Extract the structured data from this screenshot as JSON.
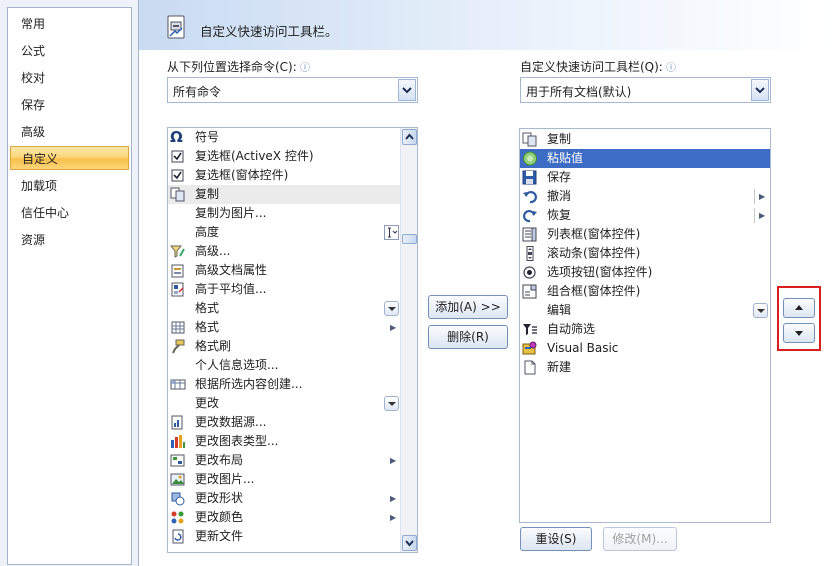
{
  "sidebar": {
    "items": [
      {
        "label": "常用",
        "active": false
      },
      {
        "label": "公式",
        "active": false
      },
      {
        "label": "校对",
        "active": false
      },
      {
        "label": "保存",
        "active": false
      },
      {
        "label": "高级",
        "active": false
      },
      {
        "label": "自定义",
        "active": true
      },
      {
        "label": "加载项",
        "active": false
      },
      {
        "label": "信任中心",
        "active": false
      },
      {
        "label": "资源",
        "active": false
      }
    ]
  },
  "header": {
    "title": "自定义快速访问工具栏。",
    "icon": "toolbar-customize-icon"
  },
  "left": {
    "label": "从下列位置选择命令(C):",
    "dropdown_value": "所有命令",
    "items": [
      {
        "label": "符号",
        "icon": "omega-icon"
      },
      {
        "label": "复选框(ActiveX 控件)",
        "icon": "checkbox-icon"
      },
      {
        "label": "复选框(窗体控件)",
        "icon": "checkbox-icon"
      },
      {
        "label": "复制",
        "icon": "copy-icon"
      },
      {
        "label": "复制为图片...",
        "icon": ""
      },
      {
        "label": "高度",
        "icon": ""
      },
      {
        "label": "高级...",
        "icon": "filter-advanced-icon"
      },
      {
        "label": "高级文档属性",
        "icon": "document-properties-icon"
      },
      {
        "label": "高于平均值...",
        "icon": "above-average-icon"
      },
      {
        "label": "格式",
        "icon": ""
      },
      {
        "label": "格式",
        "icon": "format-grid-icon"
      },
      {
        "label": "格式刷",
        "icon": "format-painter-icon"
      },
      {
        "label": "个人信息选项...",
        "icon": ""
      },
      {
        "label": "根据所选内容创建...",
        "icon": "create-from-selection-icon"
      },
      {
        "label": "更改",
        "icon": ""
      },
      {
        "label": "更改数据源...",
        "icon": "change-data-source-icon"
      },
      {
        "label": "更改图表类型...",
        "icon": "chart-type-icon"
      },
      {
        "label": "更改布局",
        "icon": "change-layout-icon"
      },
      {
        "label": "更改图片...",
        "icon": "change-picture-icon"
      },
      {
        "label": "更改形状",
        "icon": "change-shape-icon"
      },
      {
        "label": "更改颜色",
        "icon": "change-colors-icon"
      },
      {
        "label": "更新文件",
        "icon": "update-file-icon"
      }
    ]
  },
  "right": {
    "label": "自定义快速访问工具栏(Q):",
    "dropdown_value": "用于所有文档(默认)",
    "items": [
      {
        "label": "复制",
        "icon": "copy-icon"
      },
      {
        "label": "粘贴值",
        "icon": "paste-values-icon"
      },
      {
        "label": "保存",
        "icon": "save-icon"
      },
      {
        "label": "撤消",
        "icon": "undo-icon"
      },
      {
        "label": "恢复",
        "icon": "redo-icon"
      },
      {
        "label": "列表框(窗体控件)",
        "icon": "listbox-icon"
      },
      {
        "label": "滚动条(窗体控件)",
        "icon": "scrollbar-control-icon"
      },
      {
        "label": "选项按钮(窗体控件)",
        "icon": "radio-icon"
      },
      {
        "label": "组合框(窗体控件)",
        "icon": "combobox-icon"
      },
      {
        "label": "编辑",
        "icon": ""
      },
      {
        "label": "自动筛选",
        "icon": "autofilter-icon"
      },
      {
        "label": "Visual Basic",
        "icon": "visual-basic-icon"
      },
      {
        "label": "新建",
        "icon": "new-document-icon"
      }
    ]
  },
  "buttons": {
    "add": "添加(A) >>",
    "remove": "删除(R)",
    "reset": "重设(S)",
    "modify": "修改(M)..."
  },
  "colors": {
    "selection_strong": "#3d6cc4",
    "active_sidebar": "#f8c04a",
    "highlight_border": "#d9201e"
  }
}
